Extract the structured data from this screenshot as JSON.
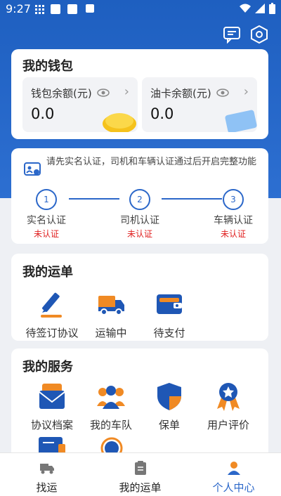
{
  "status_bar": {
    "time": "9:27"
  },
  "wallet": {
    "title": "我的钱包",
    "balance_label": "钱包余额(元)",
    "balance_value": "0.0",
    "fuel_label": "油卡余额(元)",
    "fuel_value": "0.0"
  },
  "verify": {
    "notice": "请先实名认证，司机和车辆认证通过后开启完整功能",
    "steps": [
      {
        "num": "1",
        "name": "实名认证",
        "status": "未认证"
      },
      {
        "num": "2",
        "name": "司机认证",
        "status": "未认证"
      },
      {
        "num": "3",
        "name": "车辆认证",
        "status": "未认证"
      }
    ]
  },
  "orders": {
    "title": "我的运单",
    "items": [
      {
        "label": "待签订协议",
        "icon": "pen-icon"
      },
      {
        "label": "运输中",
        "icon": "truck-icon"
      },
      {
        "label": "待支付",
        "icon": "wallet-icon"
      }
    ]
  },
  "services": {
    "title": "我的服务",
    "items": [
      {
        "label": "协议档案",
        "icon": "contract-envelope-icon"
      },
      {
        "label": "我的车队",
        "icon": "team-icon"
      },
      {
        "label": "保单",
        "icon": "shield-icon"
      },
      {
        "label": "用户评价",
        "icon": "medal-icon"
      }
    ]
  },
  "tabbar": {
    "tabs": [
      {
        "label": "找运",
        "icon": "truck-icon"
      },
      {
        "label": "我的运单",
        "icon": "clipboard-icon"
      },
      {
        "label": "个人中心",
        "icon": "person-icon",
        "active": true
      }
    ]
  },
  "colors": {
    "brand": "#2b67c9",
    "warning": "#e02020",
    "accent_orange": "#f08a24"
  }
}
